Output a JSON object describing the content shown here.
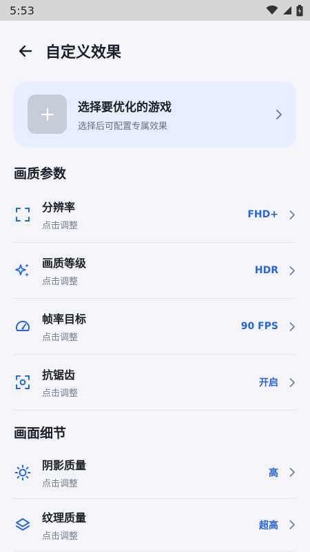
{
  "status": {
    "time": "5:53"
  },
  "header": {
    "title": "自定义效果"
  },
  "game_card": {
    "title": "选择要优化的游戏",
    "subtitle": "选择后可配置专属效果"
  },
  "sections": [
    {
      "title": "画质参数",
      "items": [
        {
          "label": "分辨率",
          "hint": "点击调整",
          "value": "FHD+",
          "icon": "resolution-icon"
        },
        {
          "label": "画质等级",
          "hint": "点击调整",
          "value": "HDR",
          "icon": "sparkle-icon"
        },
        {
          "label": "帧率目标",
          "hint": "点击调整",
          "value": "90 FPS",
          "icon": "speedometer-icon"
        },
        {
          "label": "抗锯齿",
          "hint": "点击调整",
          "value": "开启",
          "icon": "focus-icon"
        }
      ]
    },
    {
      "title": "画面细节",
      "items": [
        {
          "label": "阴影质量",
          "hint": "点击调整",
          "value": "高",
          "icon": "brightness-icon"
        },
        {
          "label": "纹理质量",
          "hint": "点击调整",
          "value": "超高",
          "icon": "layers-icon"
        }
      ]
    }
  ],
  "colors": {
    "accent": "#2a64d8",
    "card_bg": "#e6eeff",
    "page_bg": "#f3f5fa"
  }
}
